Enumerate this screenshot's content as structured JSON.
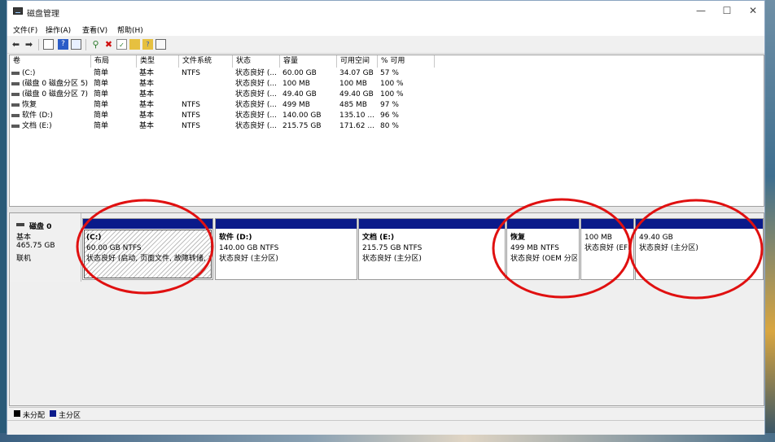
{
  "window": {
    "title": "磁盘管理",
    "min_label": "—",
    "max_label": "☐",
    "close_label": "✕"
  },
  "menu": [
    "文件(F)",
    "操作(A)",
    "查看(V)",
    "帮助(H)"
  ],
  "table": {
    "headers": [
      "卷",
      "布局",
      "类型",
      "文件系统",
      "状态",
      "容量",
      "可用空间",
      "% 可用"
    ],
    "rows": [
      [
        "(C:)",
        "简单",
        "基本",
        "NTFS",
        "状态良好 (...",
        "60.00 GB",
        "34.07 GB",
        "57 %"
      ],
      [
        "(磁盘 0 磁盘分区 5)",
        "简单",
        "基本",
        "",
        "状态良好 (...",
        "100 MB",
        "100 MB",
        "100 %"
      ],
      [
        "(磁盘 0 磁盘分区 7)",
        "简单",
        "基本",
        "",
        "状态良好 (...",
        "49.40 GB",
        "49.40 GB",
        "100 %"
      ],
      [
        "恢复",
        "简单",
        "基本",
        "NTFS",
        "状态良好 (...",
        "499 MB",
        "485 MB",
        "97 %"
      ],
      [
        "软件 (D:)",
        "简单",
        "基本",
        "NTFS",
        "状态良好 (...",
        "140.00 GB",
        "135.10 ...",
        "96 %"
      ],
      [
        "文档 (E:)",
        "简单",
        "基本",
        "NTFS",
        "状态良好 (...",
        "215.75 GB",
        "171.62 ...",
        "80 %"
      ]
    ]
  },
  "disk": {
    "name": "磁盘 0",
    "type": "基本",
    "size": "465.75 GB",
    "status": "联机"
  },
  "partitions": [
    {
      "label": "(C:)",
      "size": "60.00 GB NTFS",
      "status": "状态良好 (启动, 页面文件, 故障转储, 主分区)"
    },
    {
      "label": "软件  (D:)",
      "size": "140.00 GB NTFS",
      "status": "状态良好 (主分区)"
    },
    {
      "label": "文档  (E:)",
      "size": "215.75 GB NTFS",
      "status": "状态良好 (主分区)"
    },
    {
      "label": "恢复",
      "size": "499 MB NTFS",
      "status": "状态良好 (OEM 分区)"
    },
    {
      "label": "",
      "size": "100 MB",
      "status": "状态良好 (EFI 系统分区)"
    },
    {
      "label": "",
      "size": "49.40 GB",
      "status": "状态良好 (主分区)"
    }
  ],
  "legend": [
    {
      "label": "未分配",
      "color": "#000000"
    },
    {
      "label": "主分区",
      "color": "#0a1a8a"
    }
  ],
  "colors": {
    "primary_partition": "#0a1a8a",
    "annotation": "#e01010"
  }
}
